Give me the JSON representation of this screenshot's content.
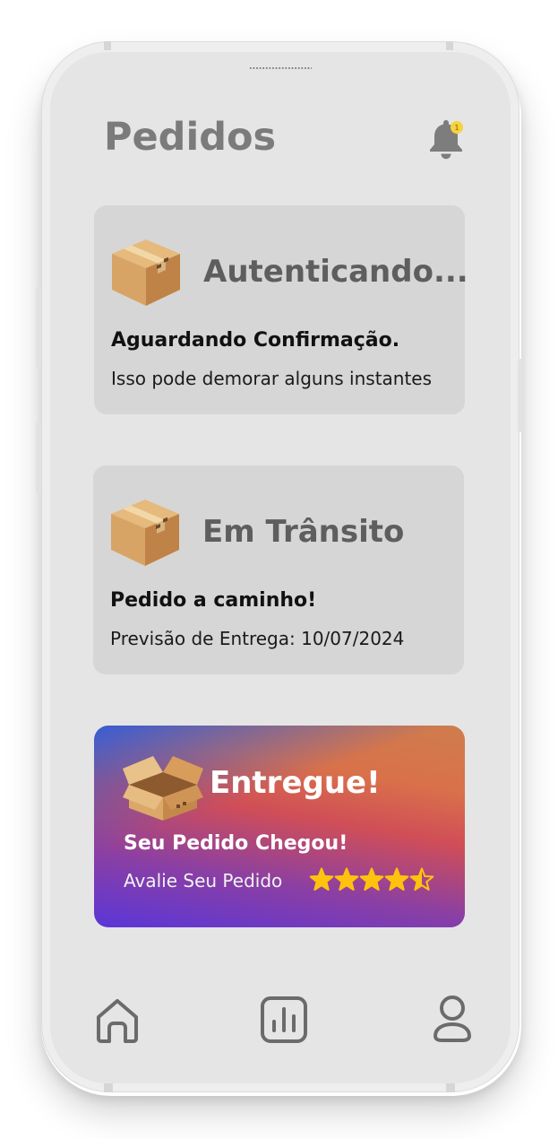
{
  "header": {
    "title": "Pedidos",
    "notification_count": "1"
  },
  "orders": [
    {
      "status": "Autenticando...",
      "subtitle": "Aguardando Confirmação.",
      "description": "Isso pode demorar alguns instantes",
      "icon": "package-closed-icon"
    },
    {
      "status": "Em Trânsito",
      "subtitle": "Pedido a caminho!",
      "description": "Previsão de Entrega: 10/07/2024",
      "icon": "package-closed-icon"
    },
    {
      "status": "Entregue!",
      "subtitle": "Seu Pedido Chegou!",
      "rate_label": "Avalie Seu Pedido",
      "rating": 4.5,
      "rating_max": 5,
      "icon": "package-open-icon"
    }
  ],
  "bottom_nav": [
    {
      "icon": "home-icon"
    },
    {
      "icon": "chart-icon"
    },
    {
      "icon": "user-icon"
    }
  ],
  "colors": {
    "background": "#e5e5e5",
    "card": "#d6d6d6",
    "title": "#7b7b7b",
    "star": "#ffc20e",
    "badge": "#f6d23c"
  }
}
